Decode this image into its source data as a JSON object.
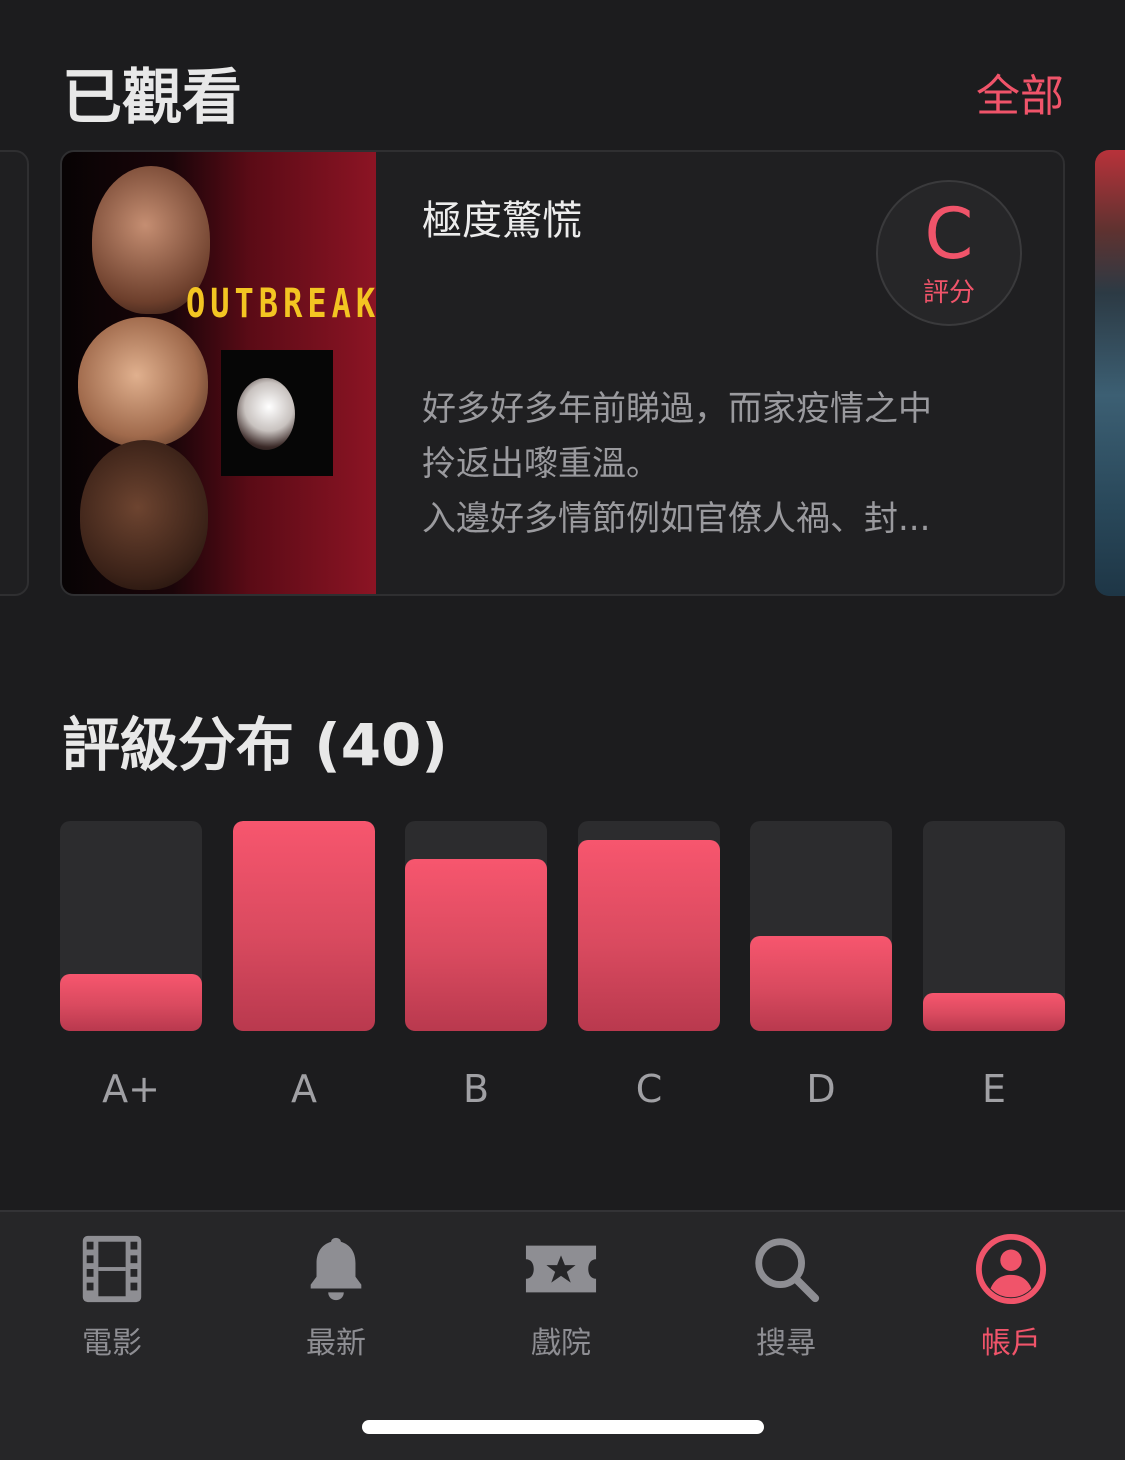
{
  "watched": {
    "title": "已觀看",
    "see_all": "全部",
    "card": {
      "poster_title": "OUTBREAK",
      "movie_title": "極度驚慌",
      "grade": "C",
      "grade_caption": "評分",
      "review_lines": [
        "好多好多年前睇過，而家疫情之中",
        "拎返出嚟重溫。",
        "入邊好多情節例如官僚人禍、封..."
      ]
    }
  },
  "distribution": {
    "title": "評級分布 (40)"
  },
  "chart_data": {
    "type": "bar",
    "categories": [
      "A+",
      "A",
      "B",
      "C",
      "D",
      "E"
    ],
    "values": [
      0.27,
      1.0,
      0.82,
      0.91,
      0.45,
      0.18
    ],
    "value_unit": "fraction of tallest bar",
    "colors": {
      "fill": "#f0546a",
      "track": "#2c2c2e"
    }
  },
  "tabbar": {
    "items": [
      {
        "label": "電影",
        "icon": "film-icon",
        "active": false
      },
      {
        "label": "最新",
        "icon": "bell-icon",
        "active": false
      },
      {
        "label": "戲院",
        "icon": "ticket-star-icon",
        "active": false
      },
      {
        "label": "搜尋",
        "icon": "search-icon",
        "active": false
      },
      {
        "label": "帳戶",
        "icon": "account-icon",
        "active": true
      }
    ]
  },
  "colors": {
    "accent": "#f0546a",
    "background": "#1c1c1e",
    "inactive_icon": "#8e8e93"
  }
}
